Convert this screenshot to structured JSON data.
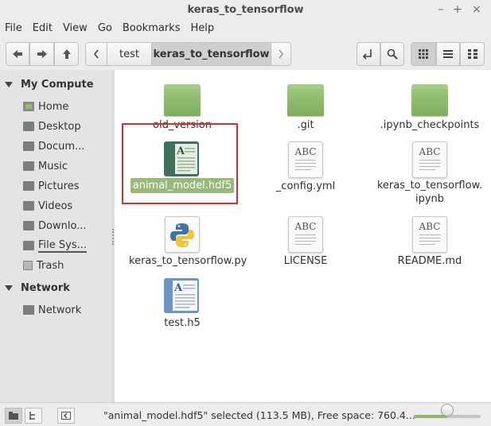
{
  "window": {
    "title": "keras_to_tensorflow",
    "controls": {
      "minimize": "–",
      "maximize": "+",
      "close": "×"
    }
  },
  "menu": [
    "File",
    "Edit",
    "View",
    "Go",
    "Bookmarks",
    "Help"
  ],
  "toolbar": {
    "back_icon": "arrow-left-icon",
    "forward_icon": "arrow-right-icon",
    "up_icon": "arrow-up-icon",
    "breadcrumbs": [
      "test",
      "keras_to_tensorflow"
    ],
    "active_breadcrumb": "keras_to_tensorflow"
  },
  "sidebar": {
    "sections": [
      {
        "label": "My Compute",
        "items": [
          {
            "label": "Home",
            "icon": "home-folder-icon"
          },
          {
            "label": "Desktop",
            "icon": "desktop-folder-icon"
          },
          {
            "label": "Docum...",
            "icon": "documents-folder-icon"
          },
          {
            "label": "Music",
            "icon": "music-folder-icon"
          },
          {
            "label": "Pictures",
            "icon": "pictures-folder-icon"
          },
          {
            "label": "Videos",
            "icon": "videos-folder-icon"
          },
          {
            "label": "Downlo...",
            "icon": "downloads-folder-icon"
          },
          {
            "label": "File Sys...",
            "icon": "filesystem-icon"
          },
          {
            "label": "Trash",
            "icon": "trash-icon"
          }
        ]
      },
      {
        "label": "Network",
        "items": [
          {
            "label": "Network",
            "icon": "network-folder-icon"
          }
        ]
      }
    ]
  },
  "files": [
    {
      "name": "old_version",
      "type": "folder"
    },
    {
      "name": ".git",
      "type": "folder"
    },
    {
      "name": ".ipynb_checkpoints",
      "type": "folder"
    },
    {
      "name": "animal_model.hdf5",
      "type": "book",
      "selected": true
    },
    {
      "name": "_config.yml",
      "type": "text"
    },
    {
      "name": "keras_to_tensorflow.\nipynb",
      "name_line1": "keras_to_tensorflow.",
      "name_line2": "ipynb",
      "type": "text"
    },
    {
      "name": "keras_to_tensorflow.py",
      "type": "python"
    },
    {
      "name": "LICENSE",
      "type": "text"
    },
    {
      "name": "README.md",
      "type": "text"
    },
    {
      "name": "test.h5",
      "type": "document"
    }
  ],
  "text_icon_label": "ABC",
  "status": {
    "text": "\"animal_model.hdf5\" selected (113.5 MB), Free space: 760.4...",
    "zoom_level": 0.5
  },
  "colors": {
    "accent": "#9ab87c",
    "selection_highlight": "#dd2a2a",
    "folder": "#8fbb6c"
  }
}
